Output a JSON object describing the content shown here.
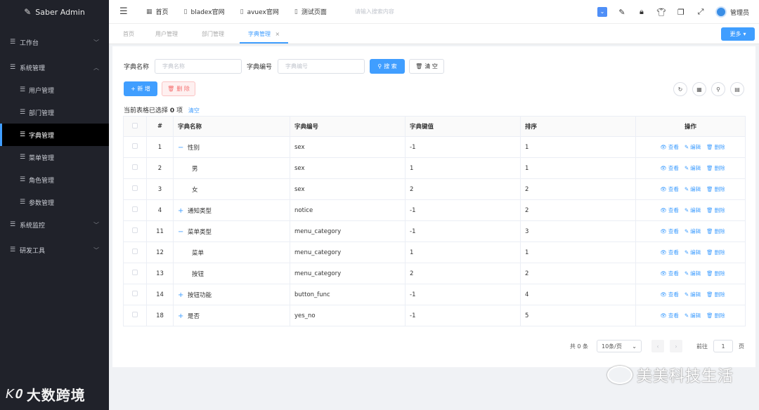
{
  "brand": {
    "title": "Saber Admin"
  },
  "sidebar": {
    "items": [
      {
        "label": "工作台"
      },
      {
        "label": "系统管理"
      },
      {
        "label": "系统监控"
      },
      {
        "label": "研发工具"
      }
    ],
    "sub_items": [
      {
        "label": "用户管理"
      },
      {
        "label": "部门管理"
      },
      {
        "label": "字典管理"
      },
      {
        "label": "菜单管理"
      },
      {
        "label": "角色管理"
      },
      {
        "label": "参数管理"
      }
    ],
    "watermark": "大数跨境"
  },
  "topbar": {
    "links": [
      {
        "label": "首页"
      },
      {
        "label": "bladex官网"
      },
      {
        "label": "avuex官网"
      },
      {
        "label": "测试页面"
      }
    ],
    "search_placeholder": "请输入搜索内容",
    "user": "管理员"
  },
  "tags": [
    {
      "label": "首页"
    },
    {
      "label": "用户管理"
    },
    {
      "label": "部门管理"
    },
    {
      "label": "字典管理"
    }
  ],
  "more_label": "更多",
  "search": {
    "name_label": "字典名称",
    "name_placeholder": "字典名称",
    "code_label": "字典编号",
    "code_placeholder": "字典编号",
    "search_btn": "搜 索",
    "clear_btn": "清 空"
  },
  "actions": {
    "add": "+ 新 增",
    "delete": "删 除"
  },
  "selection": {
    "prefix": "当前表格已选择",
    "count": "0",
    "suffix": "项",
    "clear": "清空"
  },
  "table": {
    "headers": [
      "#",
      "字典名称",
      "字典编号",
      "字典键值",
      "排序",
      "操作"
    ],
    "rows": [
      {
        "id": "1",
        "name": "性别",
        "code": "sex",
        "key": "-1",
        "sort": "1",
        "tree": "−"
      },
      {
        "id": "2",
        "name": "男",
        "code": "sex",
        "key": "1",
        "sort": "1",
        "tree": ""
      },
      {
        "id": "3",
        "name": "女",
        "code": "sex",
        "key": "2",
        "sort": "2",
        "tree": ""
      },
      {
        "id": "4",
        "name": "通知类型",
        "code": "notice",
        "key": "-1",
        "sort": "2",
        "tree": "+"
      },
      {
        "id": "11",
        "name": "菜单类型",
        "code": "menu_category",
        "key": "-1",
        "sort": "3",
        "tree": "−"
      },
      {
        "id": "12",
        "name": "菜单",
        "code": "menu_category",
        "key": "1",
        "sort": "1",
        "tree": ""
      },
      {
        "id": "13",
        "name": "按钮",
        "code": "menu_category",
        "key": "2",
        "sort": "2",
        "tree": ""
      },
      {
        "id": "14",
        "name": "按钮功能",
        "code": "button_func",
        "key": "-1",
        "sort": "4",
        "tree": "+"
      },
      {
        "id": "18",
        "name": "是否",
        "code": "yes_no",
        "key": "-1",
        "sort": "5",
        "tree": "+"
      }
    ],
    "ops": {
      "view": "查看",
      "edit": "编辑",
      "delete": "删除"
    }
  },
  "pagination": {
    "total": "共 0 条",
    "page_size": "10条/页",
    "goto": "前往",
    "page": "1",
    "page_suffix": "页"
  },
  "watermark_right": "美美科技生活"
}
